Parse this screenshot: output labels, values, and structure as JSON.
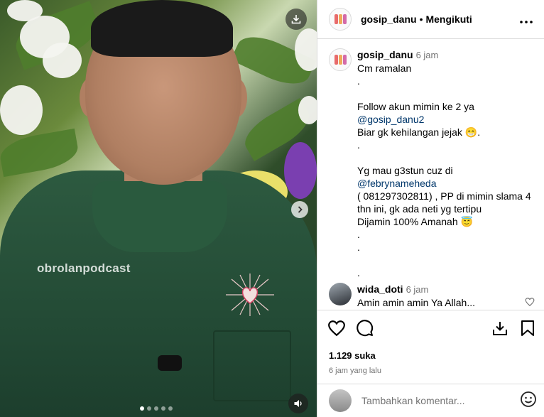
{
  "post": {
    "media": {
      "watermark": "obrolanpodcast",
      "carousel_count": 5,
      "carousel_active": 0,
      "icons": [
        "download-icon",
        "chevron-right-icon",
        "volume-icon"
      ]
    }
  },
  "header": {
    "username": "gosip_danu",
    "separator": "•",
    "follow_status": "Mengikuti",
    "more": "•••"
  },
  "caption": {
    "username": "gosip_danu",
    "time": "6 jam",
    "lines": [
      {
        "text": "Cm ramalan"
      },
      {
        "text": "."
      },
      {
        "text": " "
      },
      {
        "text": "Follow akun mimin ke 2 ya"
      },
      {
        "mention": "@gosip_danu2"
      },
      {
        "text": "Biar gk kehilangan jejak 😁."
      },
      {
        "text": "."
      },
      {
        "text": " "
      },
      {
        "prefix": "Yg mau g3stun cuz di ",
        "mention": "@febrynameheda"
      },
      {
        "text": "( 081297302811) , PP di mimin slama 4"
      },
      {
        "text": "thn ini, gk ada neti yg tertipu"
      },
      {
        "text": "Dijamin 100% Amanah 😇"
      },
      {
        "text": "."
      },
      {
        "text": "."
      },
      {
        "text": " "
      },
      {
        "text": "."
      }
    ]
  },
  "comment": {
    "username": "wida_doti",
    "time": "6 jam",
    "text": "Amin amin amin Ya Allah..."
  },
  "actions": {
    "likes": "1.129 suka",
    "posted_ago": "6 jam yang lalu"
  },
  "add_comment": {
    "placeholder": "Tambahkan komentar..."
  },
  "colors": {
    "mention": "#00376b",
    "muted": "#737373",
    "border": "#dbdbdb"
  }
}
